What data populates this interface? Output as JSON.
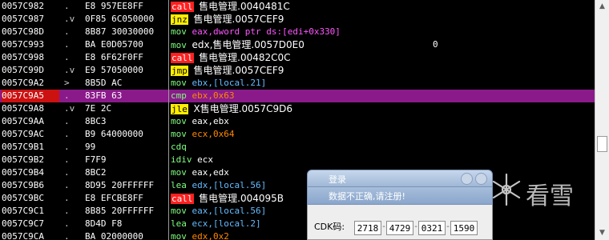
{
  "disassembly": [
    {
      "addr": "0057C982",
      "mark": ".",
      "bytes": "E8 957EE8FF",
      "mnemonic": "call",
      "operand": "售电管理.0040481C",
      "style": "call",
      "extra": ""
    },
    {
      "addr": "0057C987",
      "mark": ".v",
      "bytes": "0F85 6C050000",
      "mnemonic": "jnz",
      "operand": "售电管理.0057CEF9",
      "style": "jmp",
      "extra": ""
    },
    {
      "addr": "0057C98D",
      "mark": ".",
      "bytes": "8B87 30030000",
      "mnemonic": "mov",
      "operand": "eax,dword ptr ds:[edi+0x330]",
      "style": "mag",
      "extra": ""
    },
    {
      "addr": "0057C993",
      "mark": ".",
      "bytes": "BA E0D05700",
      "mnemonic": "mov",
      "operand": "edx,售电管理.0057D0E0",
      "style": "str",
      "extra": "0"
    },
    {
      "addr": "0057C998",
      "mark": ".",
      "bytes": "E8 6F62F0FF",
      "mnemonic": "call",
      "operand": "售电管理.00482C0C",
      "style": "call",
      "extra": ""
    },
    {
      "addr": "0057C99D",
      "mark": ".v",
      "bytes": "E9 57050000",
      "mnemonic": "jmp",
      "operand": "售电管理.0057CEF9",
      "style": "jmp",
      "extra": ""
    },
    {
      "addr": "0057C9A2",
      "mark": ">",
      "bytes": "8B5D AC",
      "mnemonic": "mov",
      "operand": "ebx,[local.21]",
      "style": "blue",
      "extra": ""
    },
    {
      "addr": "0057C9A5",
      "mark": ".",
      "bytes": "83FB 63",
      "mnemonic": "cmp",
      "operand": "ebx,0x63",
      "style": "num",
      "extra": ""
    },
    {
      "addr": "0057C9A8",
      "mark": ".v",
      "bytes": "7E 2C",
      "mnemonic": "jle",
      "operand": "X售电管理.0057C9D6",
      "style": "jmp",
      "extra": ""
    },
    {
      "addr": "0057C9AA",
      "mark": ".",
      "bytes": "8BC3",
      "mnemonic": "mov",
      "operand": "eax,ebx",
      "style": "plain",
      "extra": ""
    },
    {
      "addr": "0057C9AC",
      "mark": ".",
      "bytes": "B9 64000000",
      "mnemonic": "mov",
      "operand": "ecx,0x64",
      "style": "num",
      "extra": ""
    },
    {
      "addr": "0057C9B1",
      "mark": ".",
      "bytes": "99",
      "mnemonic": "cdq",
      "operand": "",
      "style": "plain",
      "extra": ""
    },
    {
      "addr": "0057C9B2",
      "mark": ".",
      "bytes": "F7F9",
      "mnemonic": "idiv",
      "operand": "ecx",
      "style": "plain",
      "extra": ""
    },
    {
      "addr": "0057C9B4",
      "mark": ".",
      "bytes": "8BC2",
      "mnemonic": "mov",
      "operand": "eax,edx",
      "style": "plain",
      "extra": ""
    },
    {
      "addr": "0057C9B6",
      "mark": ".",
      "bytes": "8D95 20FFFFFF",
      "mnemonic": "lea",
      "operand": "edx,[local.56]",
      "style": "blue",
      "extra": ""
    },
    {
      "addr": "0057C9BC",
      "mark": ".",
      "bytes": "E8 EFCBE8FF",
      "mnemonic": "call",
      "operand": "售电管理.004095B",
      "style": "call",
      "extra": ""
    },
    {
      "addr": "0057C9C1",
      "mark": ".",
      "bytes": "8B85 20FFFFFF",
      "mnemonic": "mov",
      "operand": "eax,[local.56]",
      "style": "blue",
      "extra": ""
    },
    {
      "addr": "0057C9C7",
      "mark": ".",
      "bytes": "8D4D F8",
      "mnemonic": "lea",
      "operand": "ecx,[local.2]",
      "style": "blue",
      "extra": ""
    },
    {
      "addr": "0057C9CA",
      "mark": ".",
      "bytes": "BA 02000000",
      "mnemonic": "mov",
      "operand": "edx,0x2",
      "style": "num",
      "extra": ""
    }
  ],
  "current_row": 7,
  "dialog": {
    "title": "登录",
    "message": "数据不正确,请注册!",
    "cdk_label": "CDK码:",
    "cdk_fields": [
      "2718",
      "4729",
      "0321",
      "1590"
    ],
    "dash": "-"
  },
  "watermark": {
    "text": "看雪"
  },
  "scrollbar": {
    "up_icon": "▲",
    "down_icon": "▼",
    "position": 0.6
  }
}
